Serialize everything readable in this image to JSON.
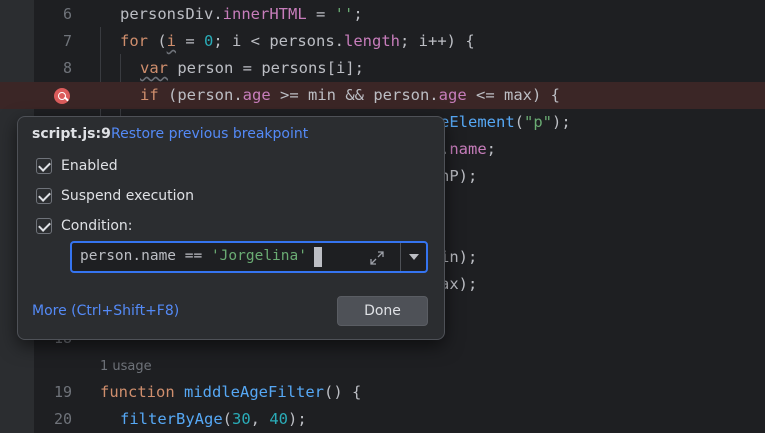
{
  "editor": {
    "lines": [
      {
        "number": "6",
        "tokens": [
          {
            "t": "personsDiv",
            "c": "var"
          },
          {
            "t": ".",
            "c": "var"
          },
          {
            "t": "innerHTML",
            "c": "prop"
          },
          {
            "t": " = ",
            "c": "var"
          },
          {
            "t": "''",
            "c": "str"
          },
          {
            "t": ";",
            "c": "var"
          }
        ]
      },
      {
        "number": "7",
        "tokens": [
          {
            "t": "for",
            "c": "kw"
          },
          {
            "t": " (",
            "c": "var"
          },
          {
            "t": "i",
            "c": "unused"
          },
          {
            "t": " = ",
            "c": "var"
          },
          {
            "t": "0",
            "c": "num"
          },
          {
            "t": "; i < persons.",
            "c": "var"
          },
          {
            "t": "length",
            "c": "prop"
          },
          {
            "t": "; i++) {",
            "c": "var"
          }
        ]
      },
      {
        "number": "8",
        "tokens": [
          {
            "t": "var",
            "c": "unused"
          },
          {
            "t": " person = persons[i];",
            "c": "var"
          }
        ]
      },
      {
        "number": "",
        "tokens": [
          {
            "t": "if",
            "c": "kw"
          },
          {
            "t": " (person.",
            "c": "var"
          },
          {
            "t": "age",
            "c": "prop"
          },
          {
            "t": " >= min && person.",
            "c": "var"
          },
          {
            "t": "age",
            "c": "prop"
          },
          {
            "t": " <= max) {",
            "c": "var"
          }
        ]
      },
      {
        "number": "",
        "tokens": [
          {
            "t": "eElement",
            "c": "fn"
          },
          {
            "t": "(",
            "c": "var"
          },
          {
            "t": "\"p\"",
            "c": "str"
          },
          {
            "t": ");",
            "c": "var"
          }
        ]
      },
      {
        "number": "",
        "tokens": [
          {
            "t": ".",
            "c": "var"
          },
          {
            "t": "name",
            "c": "prop"
          },
          {
            "t": ";",
            "c": "var"
          }
        ]
      },
      {
        "number": "",
        "tokens": [
          {
            "t": "nP);",
            "c": "var"
          }
        ]
      },
      {
        "number": "",
        "tokens": []
      },
      {
        "number": "",
        "tokens": [
          {
            "t": "in);",
            "c": "var"
          }
        ]
      },
      {
        "number": "",
        "tokens": [
          {
            "t": "ax);",
            "c": "var"
          }
        ]
      },
      {
        "number": "",
        "tokens": []
      },
      {
        "number": "18",
        "tokens": []
      },
      {
        "number": "",
        "tokens": []
      },
      {
        "number": "19",
        "tokens": [
          {
            "t": "function",
            "c": "kw"
          },
          {
            "t": " ",
            "c": "var"
          },
          {
            "t": "middleAgeFilter",
            "c": "fn"
          },
          {
            "t": "() {",
            "c": "var"
          }
        ]
      },
      {
        "number": "20",
        "tokens": [
          {
            "t": "filterByAge",
            "c": "fn"
          },
          {
            "t": "(",
            "c": "var"
          },
          {
            "t": "30",
            "c": "num"
          },
          {
            "t": ", ",
            "c": "var"
          },
          {
            "t": "40",
            "c": "num"
          },
          {
            "t": ");",
            "c": "var"
          }
        ]
      }
    ],
    "usage_hint": "1 usage"
  },
  "popup": {
    "file_label": "script.js:9",
    "restore_link": "Restore previous breakpoint",
    "enabled_label": "Enabled",
    "enabled_checked": true,
    "suspend_label": "Suspend execution",
    "suspend_checked": true,
    "condition_label": "Condition:",
    "condition_checked": true,
    "condition_prefix": "person.name == ",
    "condition_string": "'Jorgelina'",
    "more_link": "More (Ctrl+Shift+F8)",
    "done_label": "Done"
  },
  "icons": {
    "breakpoint": "breakpoint-conditional-icon",
    "expand": "expand-icon",
    "dropdown": "chevron-down-icon"
  },
  "colors": {
    "accent": "#3574f0",
    "link": "#548af7",
    "breakpoint": "#db5c5c",
    "editor_bg": "#1e1f22",
    "popup_bg": "#2b2d30"
  }
}
